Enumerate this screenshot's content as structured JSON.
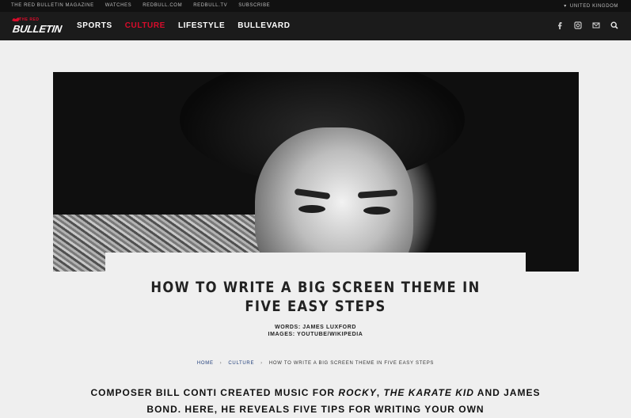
{
  "topbar": {
    "links": [
      "THE RED BULLETIN MAGAZINE",
      "WATCHES",
      "REDBULL.COM",
      "REDBULL.TV",
      "SUBSCRIBE"
    ],
    "region": "UNITED KINGDOM"
  },
  "nav": {
    "logo_top": "THE RED",
    "logo_main": "BULLETIN",
    "items": [
      {
        "label": "SPORTS",
        "active": false
      },
      {
        "label": "CULTURE",
        "active": true
      },
      {
        "label": "LIFESTYLE",
        "active": false
      },
      {
        "label": "BULLEVARD",
        "active": false
      }
    ],
    "icons": [
      "facebook-icon",
      "instagram-icon",
      "email-icon",
      "search-icon"
    ],
    "accent_color": "#d80c2b"
  },
  "article": {
    "title": "HOW TO WRITE A BIG SCREEN THEME IN FIVE EASY STEPS",
    "words": "WORDS: JAMES LUXFORD",
    "images": "IMAGES: YOUTUBE/WIKIPEDIA",
    "breadcrumb": {
      "home": "HOME",
      "section": "CULTURE",
      "current": "HOW TO WRITE A BIG SCREEN THEME IN FIVE EASY STEPS"
    },
    "intro": {
      "part1": "COMPOSER BILL CONTI CREATED MUSIC FOR ",
      "rocky": "ROCKY",
      "comma": ", ",
      "karate": "THE KARATE KID",
      "part2": " AND JAMES BOND. HERE, HE REVEALS FIVE TIPS FOR WRITING YOUR OWN"
    }
  }
}
